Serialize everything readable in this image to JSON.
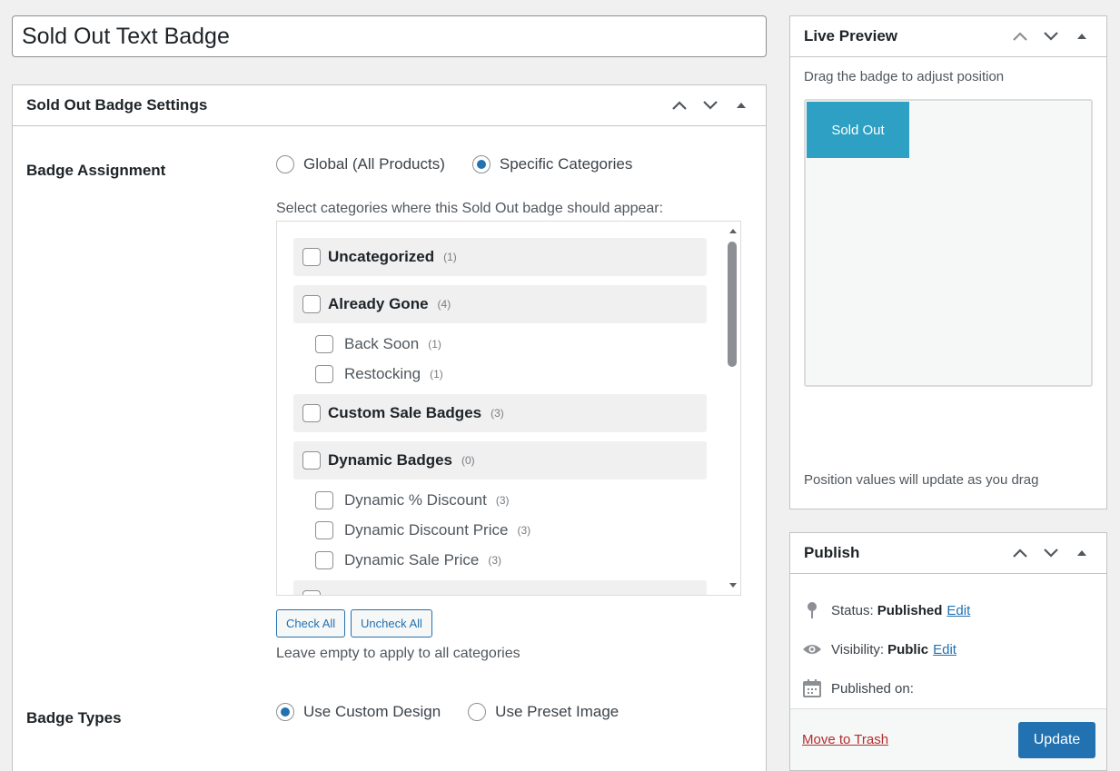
{
  "post_title": "Sold Out Text Badge",
  "settings_box": {
    "title": "Sold Out Badge Settings",
    "badge_assignment": {
      "label": "Badge Assignment",
      "options": [
        "Global (All Products)",
        "Specific Categories"
      ],
      "selected": "Specific Categories",
      "categories_help": "Select categories where this Sold Out badge should appear:",
      "categories": [
        {
          "name": "Uncategorized",
          "count": "(1)",
          "children": []
        },
        {
          "name": "Already Gone",
          "count": "(4)",
          "children": [
            {
              "name": "Back Soon",
              "count": "(1)"
            },
            {
              "name": "Restocking",
              "count": "(1)"
            }
          ]
        },
        {
          "name": "Custom Sale Badges",
          "count": "(3)",
          "children": []
        },
        {
          "name": "Dynamic Badges",
          "count": "(0)",
          "children": [
            {
              "name": "Dynamic % Discount",
              "count": "(3)"
            },
            {
              "name": "Dynamic Discount Price",
              "count": "(3)"
            },
            {
              "name": "Dynamic Sale Price",
              "count": "(3)"
            }
          ]
        }
      ],
      "check_all": "Check All",
      "uncheck_all": "Uncheck All",
      "empty_help": "Leave empty to apply to all categories"
    },
    "badge_types": {
      "label": "Badge Types",
      "options": [
        "Use Custom Design",
        "Use Preset Image"
      ],
      "selected": "Use Custom Design"
    }
  },
  "live_preview": {
    "title": "Live Preview",
    "drag_hint": "Drag the badge to adjust position",
    "badge_text": "Sold Out",
    "badge_color": "#2da0c3",
    "position_hint": "Position values will update as you drag"
  },
  "publish": {
    "title": "Publish",
    "status_label": "Status:",
    "status_value": "Published",
    "visibility_label": "Visibility:",
    "visibility_value": "Public",
    "edit_label": "Edit",
    "published_on_label": "Published on:",
    "trash_label": "Move to Trash",
    "update_label": "Update"
  }
}
